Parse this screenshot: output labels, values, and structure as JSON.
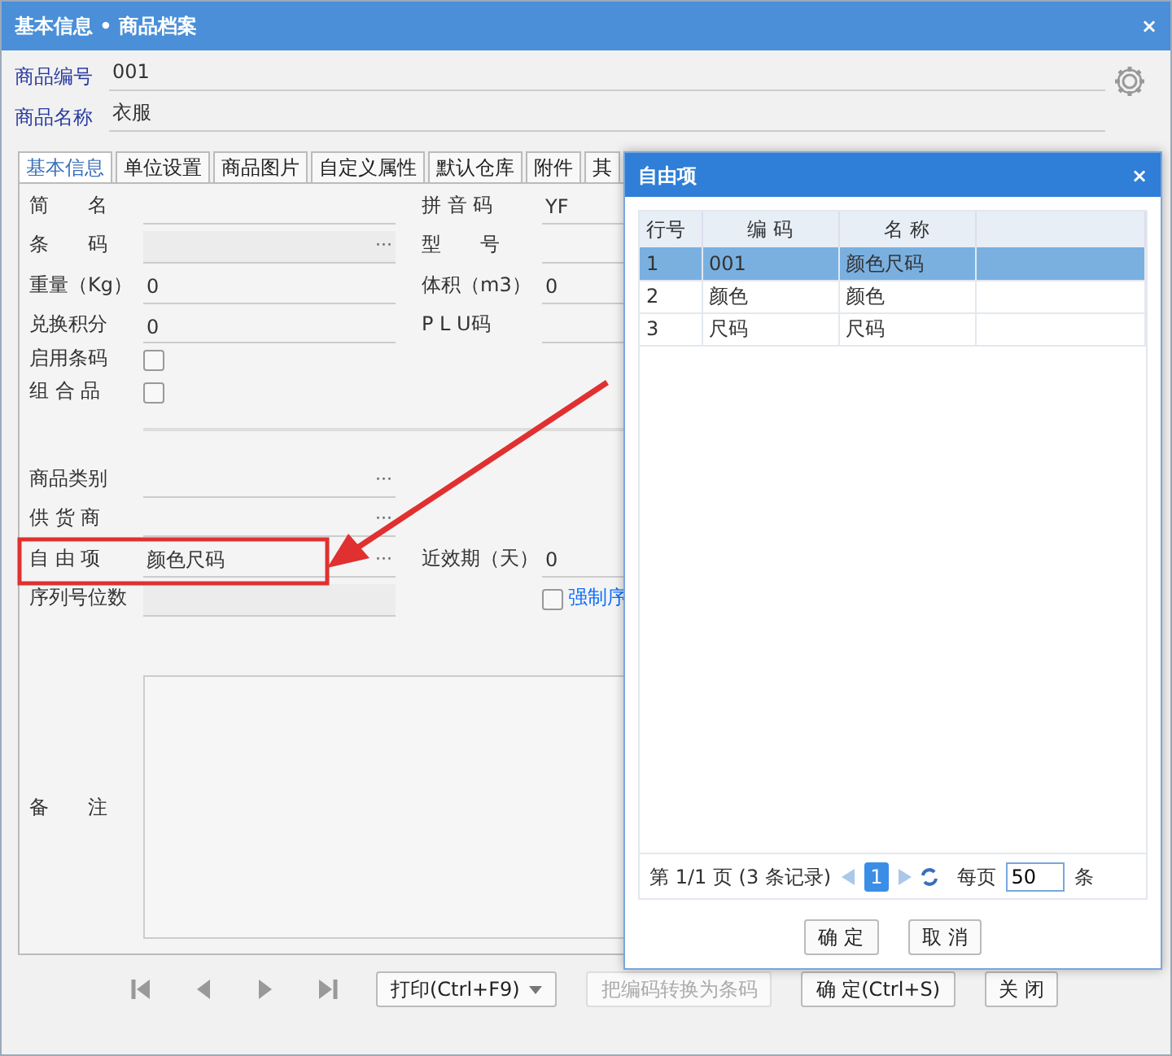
{
  "window": {
    "title": "基本信息 • 商品档案",
    "close_button": "×"
  },
  "header_fields": [
    {
      "label": "商品编号",
      "value": "001"
    },
    {
      "label": "商品名称",
      "value": "衣服"
    }
  ],
  "tabs": [
    {
      "label": "基本信息",
      "selected": true
    },
    {
      "label": "单位设置",
      "selected": false
    },
    {
      "label": "商品图片",
      "selected": false
    },
    {
      "label": "自定义属性",
      "selected": false
    },
    {
      "label": "默认仓库",
      "selected": false
    },
    {
      "label": "附件",
      "selected": false
    },
    {
      "label": "其",
      "selected": false
    }
  ],
  "form_rows": [
    {
      "left": {
        "kind": "text",
        "label": "简　　名"
      },
      "right": {
        "kind": "text",
        "label": "拼 音 码",
        "value": "YF"
      }
    },
    {
      "left": {
        "kind": "lookup",
        "label": "条　　码",
        "disabled": true,
        "button": "···"
      },
      "right": {
        "kind": "text",
        "label": "型　　号"
      }
    },
    {
      "left": {
        "kind": "text",
        "label": "重量（Kg）",
        "value": "0"
      },
      "right": {
        "kind": "text",
        "label": "体积（m3）",
        "value": "0"
      }
    },
    {
      "left": {
        "kind": "text",
        "label": "兑换积分",
        "value": "0"
      },
      "right": {
        "kind": "text",
        "label": "P L U码"
      }
    },
    {
      "left": {
        "kind": "checkbox",
        "label": "启用条码",
        "checked": false
      }
    },
    {
      "left": {
        "kind": "checkbox",
        "label": "组 合 品",
        "checked": false
      }
    },
    {
      "left": {
        "kind": "spacer"
      }
    },
    {
      "left": {
        "kind": "lookup",
        "label": "商品类别",
        "button": "···"
      }
    },
    {
      "left": {
        "kind": "lookup",
        "label": "供 货 商",
        "button": "···"
      }
    },
    {
      "left": {
        "kind": "lookup",
        "label": "自 由 项",
        "value": "颜色尺码",
        "highlighted": true,
        "button": "···"
      },
      "right": {
        "kind": "text",
        "label": "近效期（天）",
        "value": "0"
      }
    },
    {
      "left": {
        "kind": "text",
        "label": "序列号位数",
        "disabled": true
      },
      "right": {
        "kind": "checkbox",
        "label": "强制序",
        "checked": false
      }
    }
  ],
  "remarks": {
    "label": "备　　注"
  },
  "toolbar": {
    "print_button": "打印(Ctrl+F9)",
    "buttons": [
      {
        "label": "把编码转换为条码",
        "disabled": true
      },
      {
        "label": "确 定(Ctrl+S)",
        "disabled": false
      },
      {
        "label": "关 闭",
        "disabled": false
      }
    ]
  },
  "dialog": {
    "title": "自由项",
    "close_button": "×",
    "columns": [
      "行号",
      "编 码",
      "名 称"
    ],
    "rows": [
      {
        "cells": [
          "1",
          "001",
          "颜色尺码"
        ],
        "selected": true
      },
      {
        "cells": [
          "2",
          "颜色",
          "颜色"
        ],
        "selected": false
      },
      {
        "cells": [
          "3",
          "尺码",
          "尺码"
        ],
        "selected": false
      }
    ],
    "pager": {
      "summary": "第 1/1 页 (3 条记录)",
      "page": "1",
      "per_page_label": "每页",
      "per_page": "50",
      "unit": "条"
    },
    "buttons": [
      "确 定",
      "取 消"
    ]
  }
}
